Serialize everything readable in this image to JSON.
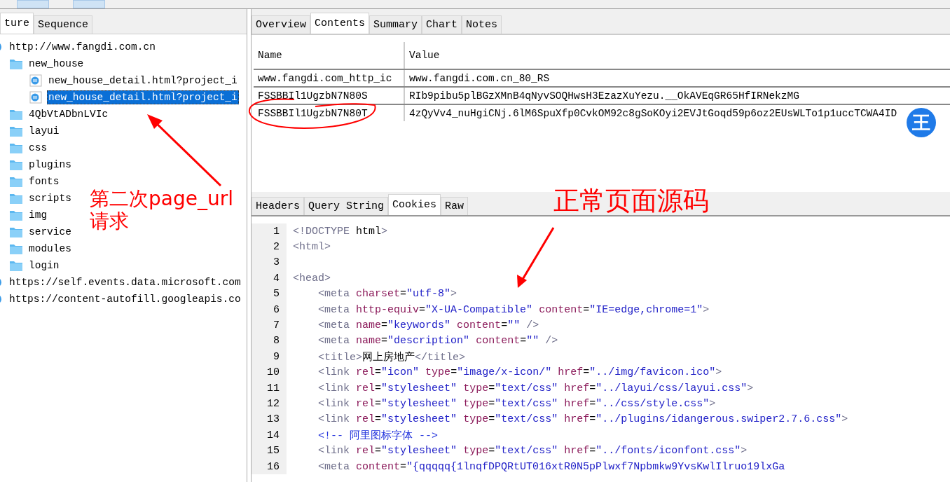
{
  "left_tabs": [
    {
      "label": "ture",
      "selected": true
    },
    {
      "label": "Sequence",
      "selected": false
    }
  ],
  "tree": [
    {
      "kind": "host",
      "label": "http://www.fangdi.com.cn",
      "selected": false,
      "children": [
        {
          "kind": "folder",
          "label": "new_house",
          "selected": false,
          "children": [
            {
              "kind": "file",
              "label": "new_house_detail.html?project_i",
              "selected": false
            },
            {
              "kind": "file",
              "label": "new_house_detail.html?project_i",
              "selected": true
            }
          ]
        },
        {
          "kind": "folder",
          "label": "4QbVtADbnLVIc",
          "selected": false
        },
        {
          "kind": "folder",
          "label": "layui",
          "selected": false
        },
        {
          "kind": "folder",
          "label": "css",
          "selected": false
        },
        {
          "kind": "folder",
          "label": "plugins",
          "selected": false
        },
        {
          "kind": "folder",
          "label": "fonts",
          "selected": false
        },
        {
          "kind": "folder",
          "label": "scripts",
          "selected": false
        },
        {
          "kind": "folder",
          "label": "img",
          "selected": false
        },
        {
          "kind": "folder",
          "label": "service",
          "selected": false
        },
        {
          "kind": "folder",
          "label": "modules",
          "selected": false
        },
        {
          "kind": "folder",
          "label": "login",
          "selected": false
        }
      ]
    },
    {
      "kind": "host",
      "label": "https://self.events.data.microsoft.com",
      "selected": false
    },
    {
      "kind": "host",
      "label": "https://content-autofill.googleapis.co",
      "selected": false
    }
  ],
  "detail_tabs": [
    {
      "label": "Overview",
      "selected": false
    },
    {
      "label": "Contents",
      "selected": true
    },
    {
      "label": "Summary",
      "selected": false
    },
    {
      "label": "Chart",
      "selected": false
    },
    {
      "label": "Notes",
      "selected": false
    }
  ],
  "cookie_table": {
    "columns": [
      "Name",
      "Value"
    ],
    "rows": [
      [
        "www.fangdi.com_http_ic",
        "www.fangdi.com.cn_80_RS"
      ],
      [
        "FSSBBIl1UgzbN7N80S",
        "RIb9pibu5plBGzXMnB4qNyvSOQHwsH3EzazXuYezu.__OkAVEqGR65HfIRNekzMG"
      ],
      [
        "FSSBBIl1UgzbN7N80T",
        "4zQyVv4_nuHgiCNj.6lM6SpuXfp0CvkOM92c8gSoKOyi2EVJtGoqd59p6oz2EUsWLTo1p1uccTCWA4ID"
      ]
    ]
  },
  "floating_badge": {
    "label": "王"
  },
  "response_tabs": [
    {
      "label": "Headers",
      "selected": false
    },
    {
      "label": "Query String",
      "selected": false
    },
    {
      "label": "Cookies",
      "selected": true
    },
    {
      "label": "Raw",
      "selected": false
    }
  ],
  "source_lines": [
    {
      "number": "1",
      "code": "<!DOCTYPE html>"
    },
    {
      "number": "2",
      "code": "<html>"
    },
    {
      "number": "3"
    },
    {
      "number": "4",
      "code": "<head>"
    },
    {
      "number": "5",
      "code": "    <meta charset=\"utf-8\">"
    },
    {
      "number": "6",
      "code": "    <meta http-equiv=\"X-UA-Compatible\" content=\"IE=edge,chrome=1\">"
    },
    {
      "number": "7",
      "code": "    <meta name=\"keywords\" content=\"\" />"
    },
    {
      "number": "8",
      "code": "    <meta name=\"description\" content=\"\" />"
    },
    {
      "number": "9",
      "code": "    <title>网上房地产</title>"
    },
    {
      "number": "10",
      "code": "    <link rel=\"icon\" type=\"image/x-icon/\" href=\"../img/favicon.ico\">"
    },
    {
      "number": "11",
      "code": "    <link rel=\"stylesheet\" type=\"text/css\" href=\"../layui/css/layui.css\">"
    },
    {
      "number": "12",
      "code": "    <link rel=\"stylesheet\" type=\"text/css\" href=\"../css/style.css\">"
    },
    {
      "number": "13",
      "code": "    <link rel=\"stylesheet\" type=\"text/css\" href=\"../plugins/idangerous.swiper2.7.6.css\">"
    },
    {
      "number": "14",
      "code": "    <!-- 阿里图标字体 -->"
    },
    {
      "number": "15",
      "code": "    <link rel=\"stylesheet\" type=\"text/css\" href=\"../fonts/iconfont.css\">"
    },
    {
      "number": "16",
      "code": "    <meta content=\"{qqqqq{1lnqfDPQRtUT016xtR0N5pPlwxf7Npbmkw9YvsKwlIlruo19lxGa"
    }
  ],
  "annotations": [
    {
      "text": "第二次page_url请求"
    },
    {
      "text": "正常页面源码"
    }
  ]
}
